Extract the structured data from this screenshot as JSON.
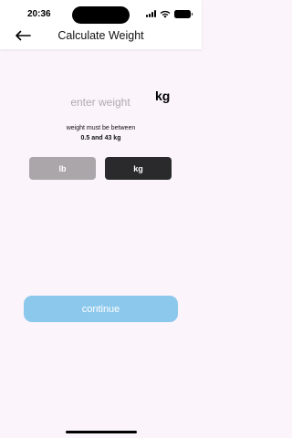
{
  "status_bar": {
    "time": "20:36"
  },
  "header": {
    "title": "Calculate Weight"
  },
  "form": {
    "weight_placeholder": "enter weight",
    "weight_value": "",
    "unit_label": "kg",
    "hint_line1": "weight must be between",
    "hint_line2": "0.5 and 43 kg"
  },
  "unit_buttons": {
    "lb_label": "lb",
    "kg_label": "kg",
    "selected": "kg"
  },
  "actions": {
    "continue_label": "continue"
  },
  "colors": {
    "background": "#fbf4fb",
    "continue": "#8cc8ec",
    "unit_selected": "#2a2a2c",
    "unit_unselected": "#aaa6aa"
  }
}
